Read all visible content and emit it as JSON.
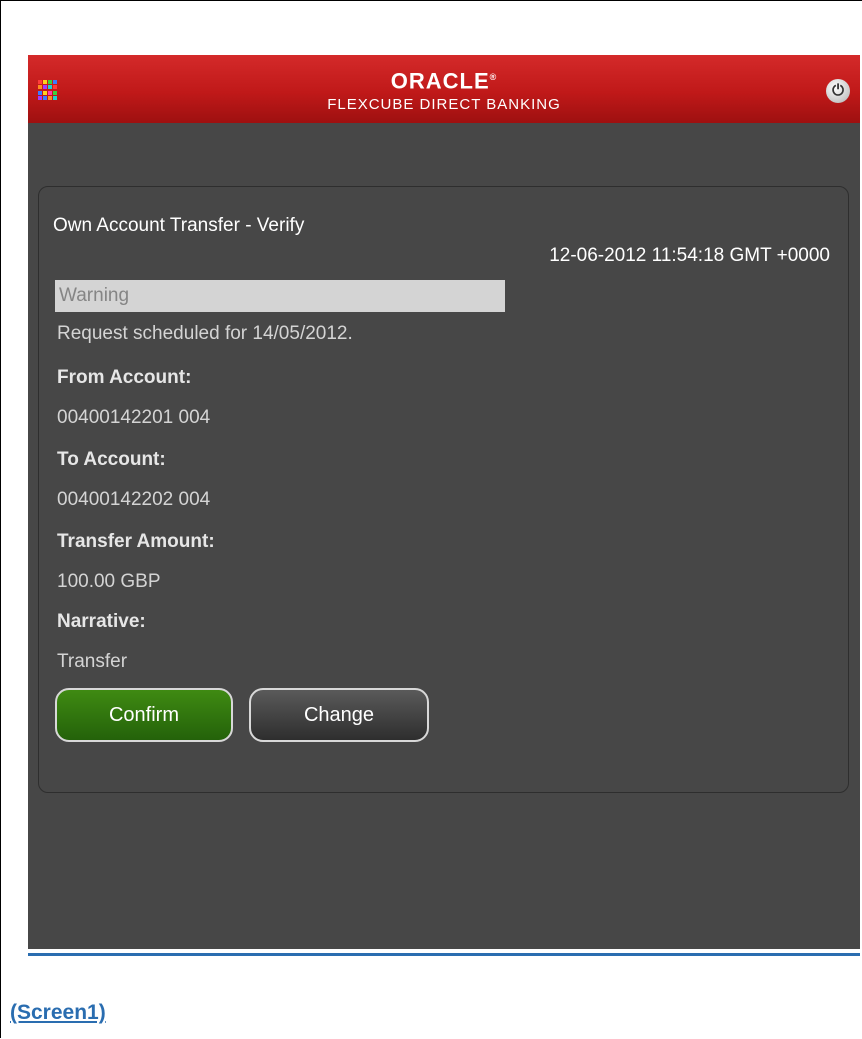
{
  "header": {
    "brand": "ORACLE",
    "brand_mark": "®",
    "subtitle": "FLEXCUBE DIRECT BANKING",
    "apps_icon": "apps-grid-icon",
    "power_icon": "power-icon"
  },
  "page": {
    "title": "Own Account Transfer - Verify",
    "timestamp": "12-06-2012 11:54:18 GMT +0000",
    "warning": "Warning",
    "message": "Request scheduled for 14/05/2012.",
    "fields": [
      {
        "label": "From Account:",
        "value": "00400142201 004"
      },
      {
        "label": "To Account:",
        "value": "00400142202 004"
      },
      {
        "label": "Transfer Amount:",
        "value": "100.00 GBP"
      },
      {
        "label": "Narrative:",
        "value": "Transfer"
      }
    ],
    "buttons": {
      "confirm": "Confirm",
      "change": "Change"
    }
  },
  "caption": "(Screen1)",
  "colors": {
    "header_red": "#c01919",
    "background": "#474747",
    "confirm_green": "#2f7510",
    "link_blue": "#2a6db0"
  }
}
